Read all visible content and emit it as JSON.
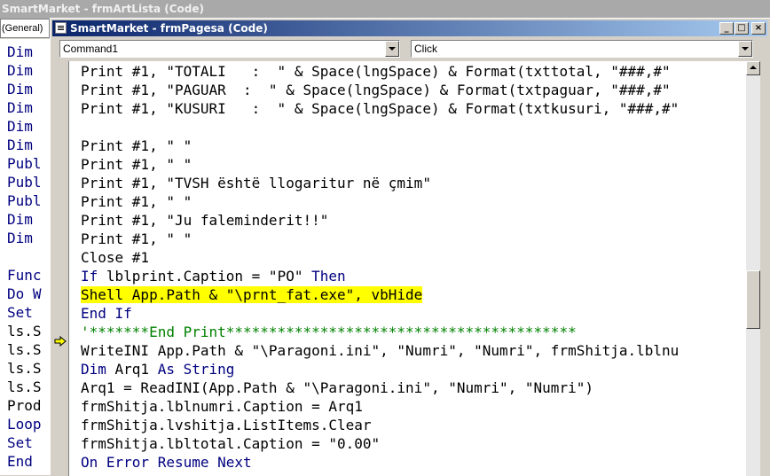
{
  "background_window": {
    "title": "SmartMarket - frmArtLista (Code)",
    "object_combo": "(General)",
    "code_lines": [
      "Dim",
      "Dim",
      "Dim",
      "Dim",
      "Dim",
      "Dim",
      "Publ",
      "Publ",
      "Publ",
      "Dim",
      "Dim",
      "",
      "Func",
      "Do W",
      "Set",
      "ls.S",
      "ls.S",
      "ls.S",
      "ls.S",
      "Prod",
      "Loop",
      "Set",
      "End"
    ]
  },
  "window": {
    "title": "SmartMarket - frmPagesa (Code)",
    "minimize_label": "_",
    "maximize_label": "□",
    "close_label": "×",
    "object_combo": "Command1",
    "procedure_combo": "Click"
  },
  "code": [
    [
      {
        "t": "Print #1, \"TOTALI   :  \" & Space(lngSpace) & Format(txttotal, \"###,#\"",
        "c": "n"
      }
    ],
    [
      {
        "t": "Print #1, \"PAGUAR  :  \" & Space(lngSpace) & Format(txtpaguar, \"###,#\"",
        "c": "n"
      }
    ],
    [
      {
        "t": "Print #1, \"KUSURI   :  \" & Space(lngSpace) & Format(txtkusuri, \"###,#\"",
        "c": "n"
      }
    ],
    [],
    [
      {
        "t": "Print #1, \" \"",
        "c": "n"
      }
    ],
    [
      {
        "t": "Print #1, \" \"",
        "c": "n"
      }
    ],
    [
      {
        "t": "Print #1, \"TVSH është llogaritur në çmim\"",
        "c": "n"
      }
    ],
    [
      {
        "t": "Print #1, \" \"",
        "c": "n"
      }
    ],
    [
      {
        "t": "Print #1, \"Ju faleminderit!!\"",
        "c": "n"
      }
    ],
    [
      {
        "t": "Print #1, \" \"",
        "c": "n"
      }
    ],
    [
      {
        "t": "Close #1",
        "c": "n"
      }
    ],
    [
      {
        "t": "If ",
        "c": "k"
      },
      {
        "t": "lblprint.Caption = \"PO\" ",
        "c": "n"
      },
      {
        "t": "Then",
        "c": "k"
      }
    ],
    [
      {
        "t": "Shell App.Path & \"\\prnt_fat.exe\", vbHide",
        "c": "h"
      }
    ],
    [
      {
        "t": "End If",
        "c": "k"
      }
    ],
    [
      {
        "t": "'*******End Print*****************************************",
        "c": "g"
      }
    ],
    [
      {
        "t": "WriteINI App.Path & \"\\Paragoni.ini\", \"Numri\", \"Numri\", frmShitja.lblnu",
        "c": "n"
      }
    ],
    [
      {
        "t": "Dim ",
        "c": "k"
      },
      {
        "t": "Arq1 ",
        "c": "n"
      },
      {
        "t": "As String",
        "c": "k"
      }
    ],
    [
      {
        "t": "Arq1 = ReadINI(App.Path & \"\\Paragoni.ini\", \"Numri\", \"Numri\")",
        "c": "n"
      }
    ],
    [
      {
        "t": "frmShitja.lblnumri.Caption = Arq1",
        "c": "n"
      }
    ],
    [
      {
        "t": "frmShitja.lvshitja.ListItems.Clear",
        "c": "n"
      }
    ],
    [
      {
        "t": "frmShitja.lbltotal.Caption = \"0.00\"",
        "c": "n"
      }
    ],
    [
      {
        "t": "On Error Resume Next",
        "c": "k"
      }
    ]
  ],
  "colors": {
    "keyword": "#000080",
    "comment": "#008000",
    "highlight": "#ffff00",
    "title_active": "#0a246a"
  },
  "icons": {
    "execution_arrow": "yellow-right-arrow-icon",
    "window_icon": "code-window-icon"
  }
}
